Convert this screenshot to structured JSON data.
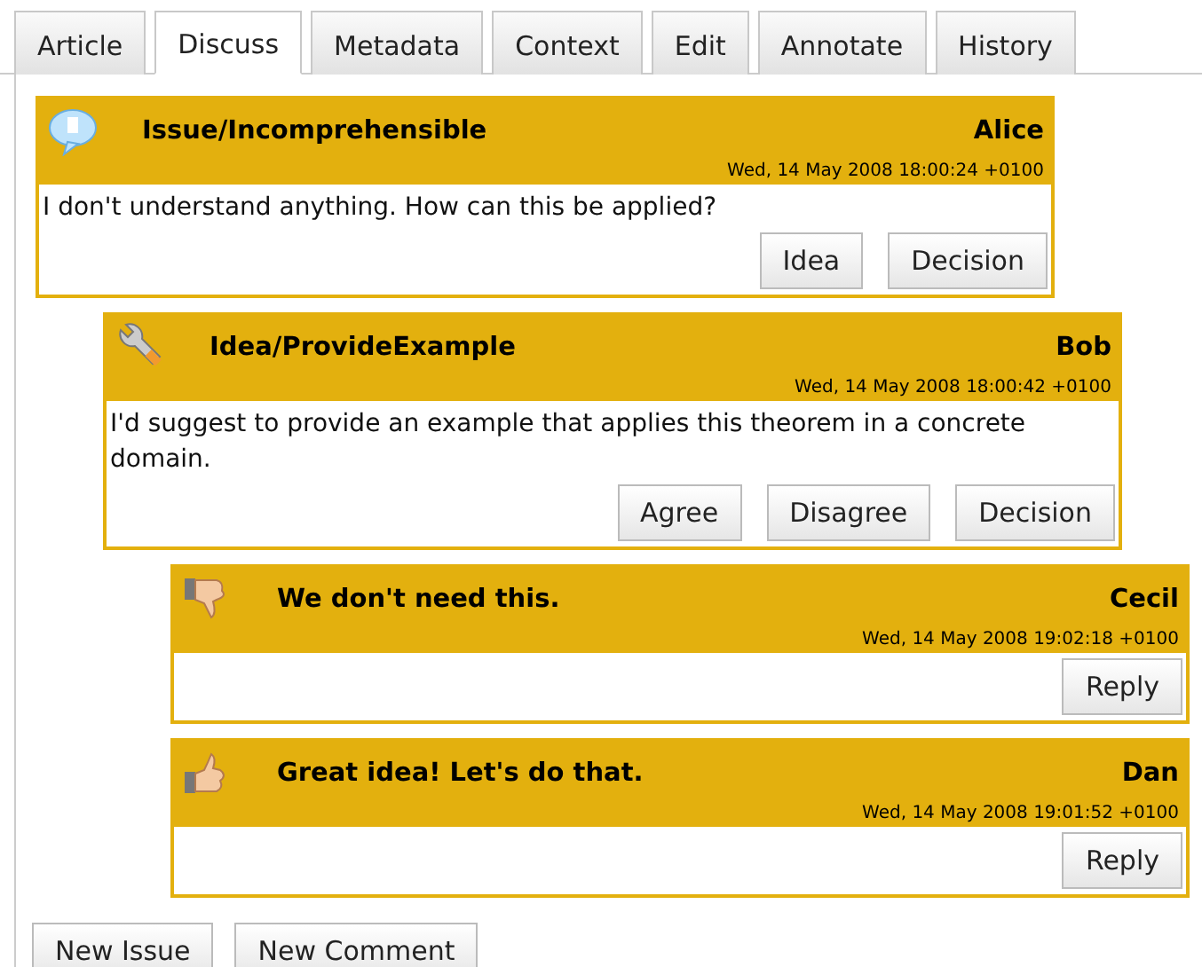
{
  "tabs": [
    {
      "label": "Article",
      "selected": false
    },
    {
      "label": "Discuss",
      "selected": true
    },
    {
      "label": "Metadata",
      "selected": false
    },
    {
      "label": "Context",
      "selected": false
    },
    {
      "label": "Edit",
      "selected": false
    },
    {
      "label": "Annotate",
      "selected": false
    },
    {
      "label": "History",
      "selected": false
    }
  ],
  "posts": [
    {
      "kind": "issue",
      "title": "Issue/Incomprehensible",
      "author": "Alice",
      "date": "Wed, 14 May 2008 18:00:24 +0100",
      "body": "I don't understand anything. How can this be applied?",
      "buttons": [
        "Idea",
        "Decision"
      ],
      "children": [
        {
          "kind": "idea",
          "title": "Idea/ProvideExample",
          "author": "Bob",
          "date": "Wed, 14 May 2008 18:00:42 +0100",
          "body": "I'd suggest to provide an example that applies this theorem in a concrete domain.",
          "buttons": [
            "Agree",
            "Disagree",
            "Decision"
          ],
          "children": [
            {
              "kind": "disagree",
              "title": "We don't need this.",
              "author": "Cecil",
              "date": "Wed, 14 May 2008 19:02:18 +0100",
              "buttons": [
                "Reply"
              ]
            },
            {
              "kind": "agree",
              "title": "Great idea! Let's do that.",
              "author": "Dan",
              "date": "Wed, 14 May 2008 19:01:52 +0100",
              "buttons": [
                "Reply"
              ]
            }
          ]
        }
      ]
    }
  ],
  "actions": [
    "New Issue",
    "New Comment"
  ]
}
